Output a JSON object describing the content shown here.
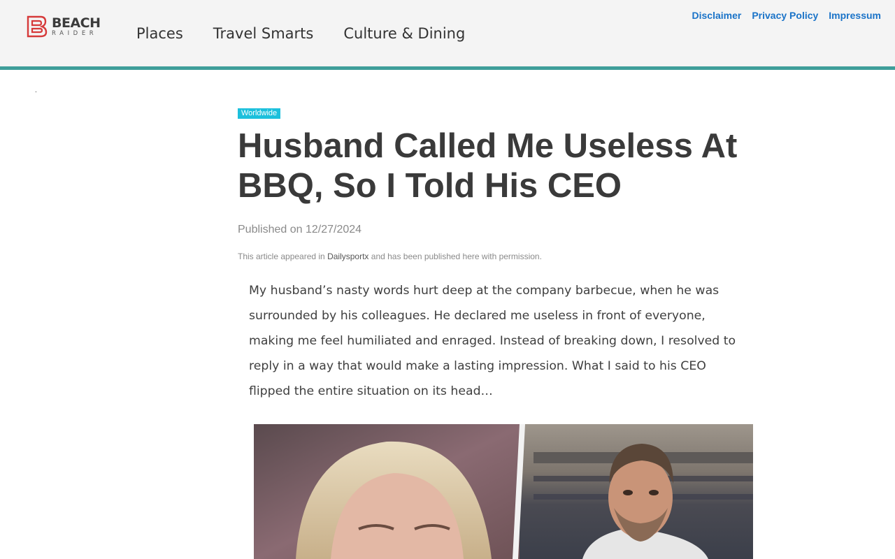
{
  "site": {
    "logo_line1": "BEACH",
    "logo_line2": "RAIDER"
  },
  "nav": {
    "items": [
      {
        "label": "Places"
      },
      {
        "label": "Travel Smarts"
      },
      {
        "label": "Culture & Dining"
      }
    ]
  },
  "utility_nav": {
    "items": [
      {
        "label": "Disclaimer"
      },
      {
        "label": "Privacy Policy"
      },
      {
        "label": "Impressum"
      }
    ]
  },
  "article": {
    "category": "Worldwide",
    "title": "Husband Called Me Useless At BBQ, So I Told His CEO",
    "published": "Published on 12/27/2024",
    "permission_prefix": "This article appeared in ",
    "permission_source": "Dailysportx",
    "permission_suffix": " and has been published here with permission.",
    "intro": "My husband’s nasty words hurt deep at the company barbecue, when he was surrounded by his colleagues. He declared me useless in front of everyone, making me feel humiliated and enraged. Instead of breaking down, I resolved to reply in a way that would make a lasting impression. What I said to his CEO flipped the entire situation on its head…"
  },
  "colors": {
    "accent_teal": "#3f9e9a",
    "badge_cyan": "#1cc0dc",
    "link_blue": "#1a73c8",
    "logo_red": "#d63a3a"
  }
}
